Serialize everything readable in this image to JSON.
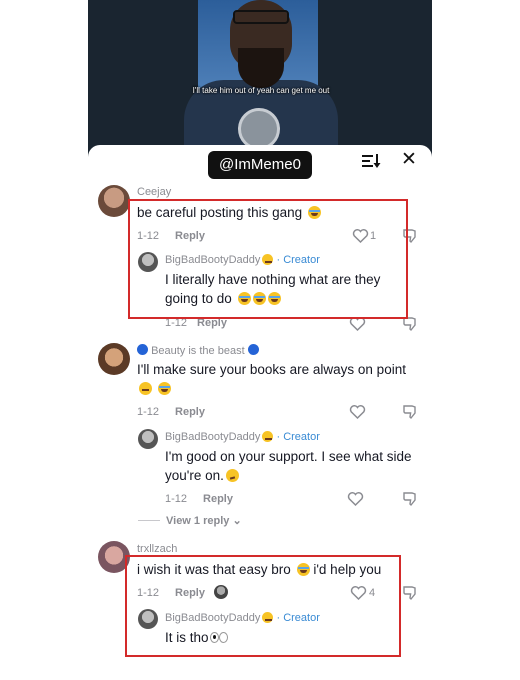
{
  "video": {
    "caption": "I'll take him out of yeah can get me out"
  },
  "header": {
    "handle": "@ImMeme0",
    "sort_icon": "sort-icon",
    "close_icon": "close-icon"
  },
  "comments": [
    {
      "username": "Ceejay",
      "text": "be careful posting this gang",
      "date": "1-12",
      "reply_label": "Reply",
      "likes": "1",
      "reply": {
        "username": "BigBadBootyDaddy",
        "creator_label": "· Creator",
        "text_line1": "I literally have nothing what are they",
        "text_line2": "going to do"
      },
      "hidden_meta": {
        "date": "1-12",
        "reply_label": "Reply"
      }
    },
    {
      "username": "Beauty is the beast",
      "text": "I'll make sure your books are always on point",
      "date": "1-12",
      "reply_label": "Reply",
      "reply": {
        "username": "BigBadBootyDaddy",
        "creator_label": "· Creator",
        "text_line1": "I'm good on your support. I see what side",
        "text_line2": "you're on.",
        "date": "1-12",
        "reply_label": "Reply"
      },
      "view_replies": "View 1 reply"
    },
    {
      "username": "trxllzach",
      "text": "i wish it was that easy bro",
      "text_end": " i'd help you",
      "date": "1-12",
      "reply_label": "Reply",
      "likes": "4",
      "reply": {
        "username": "BigBadBootyDaddy",
        "creator_label": "· Creator",
        "text": "It is tho"
      }
    }
  ],
  "colors": {
    "highlight": "#d32a2a",
    "creator": "#3a8bd4",
    "verified_dot": "#2463d6"
  }
}
